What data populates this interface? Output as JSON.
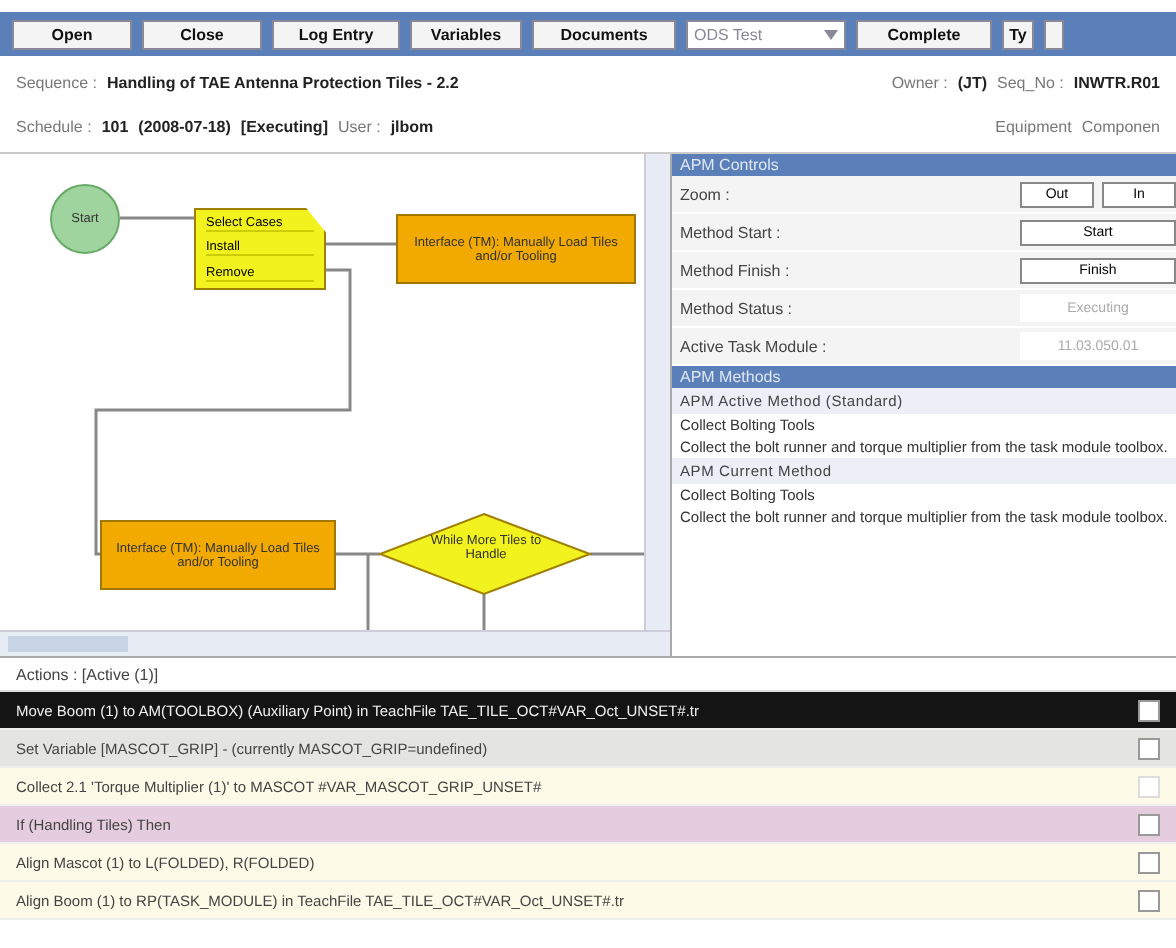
{
  "toolbar": {
    "buttons": [
      "Open",
      "Close",
      "Log Entry",
      "Variables",
      "Documents"
    ],
    "select": "ODS Test",
    "complete": "Complete",
    "small_button": "Ty"
  },
  "header": {
    "sequence_label": "Sequence :",
    "sequence": "Handling of TAE Antenna Protection Tiles - 2.2",
    "owner_label": "Owner :",
    "owner": "(JT)",
    "seq_no_label": "Seq_No :",
    "seq_no": "INWTR.R01",
    "schedule_label": "Schedule :",
    "schedule": "101",
    "date": "(2008-07-18)",
    "status": "[Executing]",
    "user_label": "User :",
    "user": "jlbom",
    "equipment": "Equipment",
    "components": "Componen"
  },
  "diagram": {
    "start": "Start",
    "note": [
      "Select Cases",
      "Install",
      "Remove"
    ],
    "task_1": "Interface (TM): Manually Load Tiles and/or Tooling",
    "task_2": "Interface (TM): Manually Load Tiles and/or Tooling",
    "decision": "While More Tiles to Handle"
  },
  "controls": {
    "title": "APM Controls",
    "rows": [
      {
        "label": "Zoom :",
        "kind": "buttons",
        "buttons": [
          "Out",
          "In"
        ]
      },
      {
        "label": "Method Start :",
        "kind": "buttons",
        "buttons": [
          "Start"
        ]
      },
      {
        "label": "Method Finish :",
        "kind": "buttons",
        "buttons": [
          "Finish"
        ]
      },
      {
        "label": "Method Status :",
        "kind": "field",
        "value": "Executing"
      },
      {
        "label": "Active Task Module :",
        "kind": "field",
        "value": "11.03.050.01"
      }
    ]
  },
  "methods": {
    "title": "APM Methods",
    "sections": [
      {
        "heading": "APM Active Method (Standard)",
        "name": "Collect Bolting Tools",
        "description": "Collect the bolt runner and torque multiplier from the task module toolbox."
      },
      {
        "heading": "APM Current Method",
        "name": "Collect Bolting Tools",
        "description": "Collect the bolt runner and torque multiplier from the task module toolbox."
      }
    ]
  },
  "actions": {
    "title": "Actions : [Active (1)]",
    "rows": [
      {
        "text": "Move Boom (1) to AM(TOOLBOX) (Auxiliary Point) in TeachFile TAE_TILE_OCT#VAR_Oct_UNSET#.tr",
        "color": "#141414",
        "checked": false,
        "disabled": false
      },
      {
        "text": "Set Variable [MASCOT_GRIP] - (currently MASCOT_GRIP=undefined)",
        "color": "#e4e4e0",
        "checked": false,
        "disabled": false
      },
      {
        "text": "Collect 2.1 'Torque Multiplier (1)' to MASCOT #VAR_MASCOT_GRIP_UNSET#",
        "color": "#fdfbe8",
        "checked": false,
        "disabled": true
      },
      {
        "text": "If (Handling Tiles) Then",
        "color": "#e6ccdf",
        "checked": false,
        "disabled": false
      },
      {
        "text": "Align Mascot (1) to L(FOLDED), R(FOLDED)",
        "color": "#fdfbe8",
        "checked": false,
        "disabled": false
      },
      {
        "text": "Align Boom (1) to RP(TASK_MODULE) in TeachFile TAE_TILE_OCT#VAR_Oct_UNSET#.tr",
        "color": "#fdfbe8",
        "checked": false,
        "disabled": false
      }
    ]
  }
}
